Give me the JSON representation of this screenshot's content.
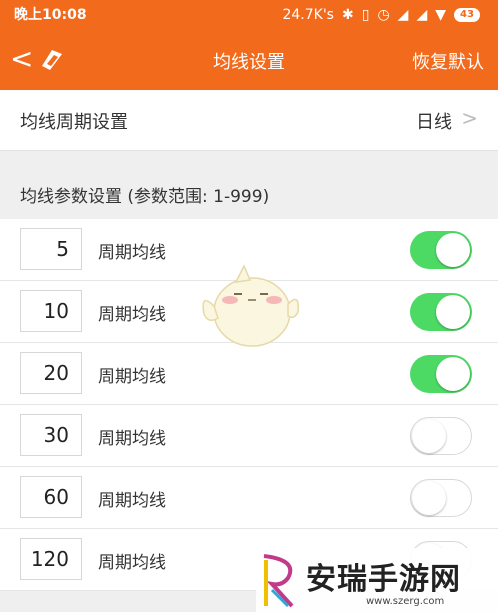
{
  "status_bar": {
    "time": "晚上10:08",
    "speed": "24.7K's",
    "battery": "43"
  },
  "nav": {
    "title": "均线设置",
    "reset_label": "恢复默认",
    "back_glyph": "<"
  },
  "period_setting": {
    "label": "均线周期设置",
    "value": "日线"
  },
  "section_header": {
    "text": "均线参数设置 (参数范围: 1-999)"
  },
  "ma_rows": [
    {
      "period": "5",
      "label": "周期均线",
      "enabled": true
    },
    {
      "period": "10",
      "label": "周期均线",
      "enabled": true
    },
    {
      "period": "20",
      "label": "周期均线",
      "enabled": true
    },
    {
      "period": "30",
      "label": "周期均线",
      "enabled": false
    },
    {
      "period": "60",
      "label": "周期均线",
      "enabled": false
    },
    {
      "period": "120",
      "label": "周期均线",
      "enabled": false
    }
  ],
  "watermark": {
    "text": "安瑞手游网",
    "url": "www.szerg.com"
  },
  "colors": {
    "header": "#f26a1c",
    "toggle_on": "#4cd964"
  }
}
